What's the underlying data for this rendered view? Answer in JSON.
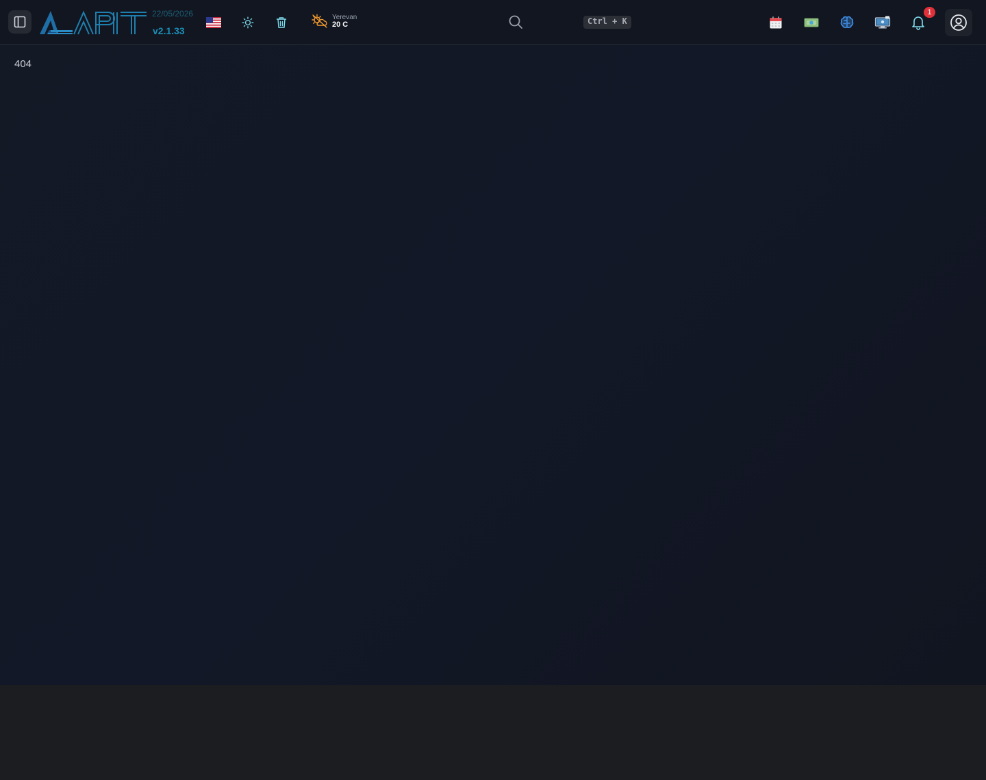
{
  "header": {
    "brand": "APIT",
    "date": "22/05/2026",
    "version": "v2.1.33",
    "language_icon": "us-flag-icon",
    "theme_icon": "sun-icon",
    "trash_icon": "trash-icon",
    "weather": {
      "icon": "cloud-sun-icon",
      "city": "Yerevan",
      "temp": "20 C"
    },
    "search": {
      "icon": "search-icon",
      "shortcut": "Ctrl + K"
    },
    "apps": [
      "calendar-icon",
      "money-icon",
      "brain-icon",
      "computer-icon"
    ],
    "notifications": {
      "icon": "bell-icon",
      "count": "1"
    },
    "user_icon": "user-circle-icon"
  },
  "main": {
    "message": "404"
  },
  "colors": {
    "accent": "#1a8fb8",
    "badge": "#e0313b",
    "background": "#131925"
  }
}
